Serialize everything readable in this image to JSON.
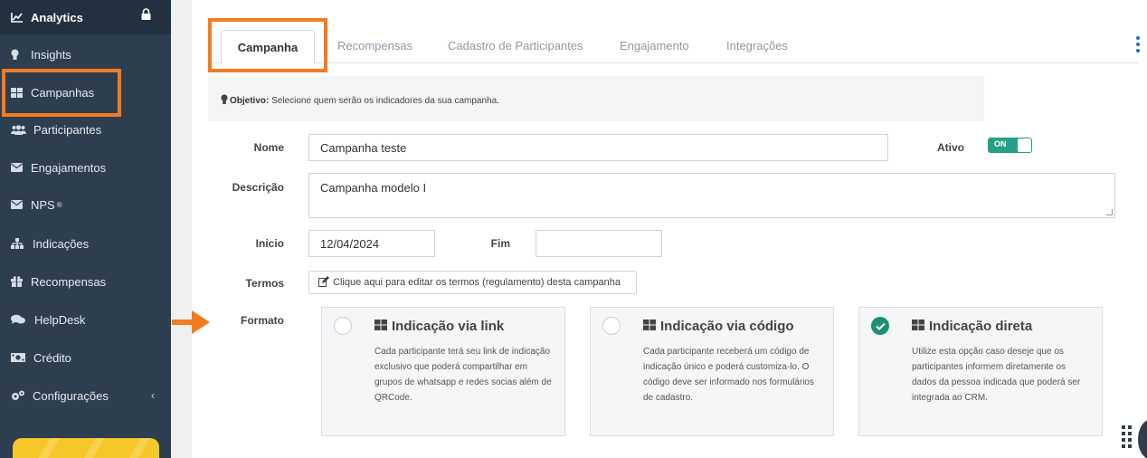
{
  "sidebar": {
    "header": {
      "label": "Analytics",
      "icon": "chart-area-icon",
      "lock_icon": "lock-icon"
    },
    "items": [
      {
        "label": "Insights",
        "icon": "lightbulb-icon"
      },
      {
        "label": "Campanhas",
        "icon": "grid-icon"
      },
      {
        "label": "Participantes",
        "icon": "users-icon"
      },
      {
        "label": "Engajamentos",
        "icon": "envelope-icon"
      },
      {
        "label": "NPS",
        "sup": "®",
        "icon": "envelope-icon"
      },
      {
        "label": "Indicações",
        "icon": "sitemap-icon"
      },
      {
        "label": "Recompensas",
        "icon": "gift-icon"
      },
      {
        "label": "HelpDesk",
        "icon": "comments-icon"
      },
      {
        "label": "Crédito",
        "icon": "money-icon"
      },
      {
        "label": "Configurações",
        "icon": "cogs-icon",
        "chevron": "‹"
      }
    ]
  },
  "tabs": [
    "Campanha",
    "Recompensas",
    "Cadastro de Participantes",
    "Engajamento",
    "Integrações"
  ],
  "objective": {
    "prefix": "Objetivo:",
    "text": " Selecione quem serão os indicadores da sua campanha."
  },
  "form": {
    "nome_label": "Nome",
    "nome_value": "Campanha teste",
    "ativo_label": "Ativo",
    "ativo_toggle": "ON",
    "descricao_label": "Descrição",
    "descricao_value": "Campanha modelo I",
    "inicio_label": "Inicio",
    "inicio_value": "12/04/2024",
    "fim_label": "Fim",
    "fim_value": "",
    "termos_label": "Termos",
    "termos_button": "Clique aqui para editar os termos (regulamento) desta campanha",
    "formato_label": "Formato"
  },
  "formats": [
    {
      "title": "Indicação via link",
      "desc": "Cada participante terá seu link de indicação exclusivo que poderá compartilhar em grupos de whatsapp e redes socias além de QRCode.",
      "selected": false
    },
    {
      "title": "Indicação via código",
      "desc": "Cada participante receberá um código de indicação único e poderá customiza-lo. O código deve ser informado nos formulários de cadastro.",
      "selected": false
    },
    {
      "title": "Indicação direta",
      "desc": "Utilize esta opção caso deseje que os participantes informem diretamente os dados da pessoa indicada que poderá ser integrada ao CRM.",
      "selected": true
    }
  ],
  "colors": {
    "sidebar_bg": "#2d3e4f",
    "highlight": "#f47b20",
    "toggle_on": "#23a085",
    "check": "#1d8f73"
  }
}
